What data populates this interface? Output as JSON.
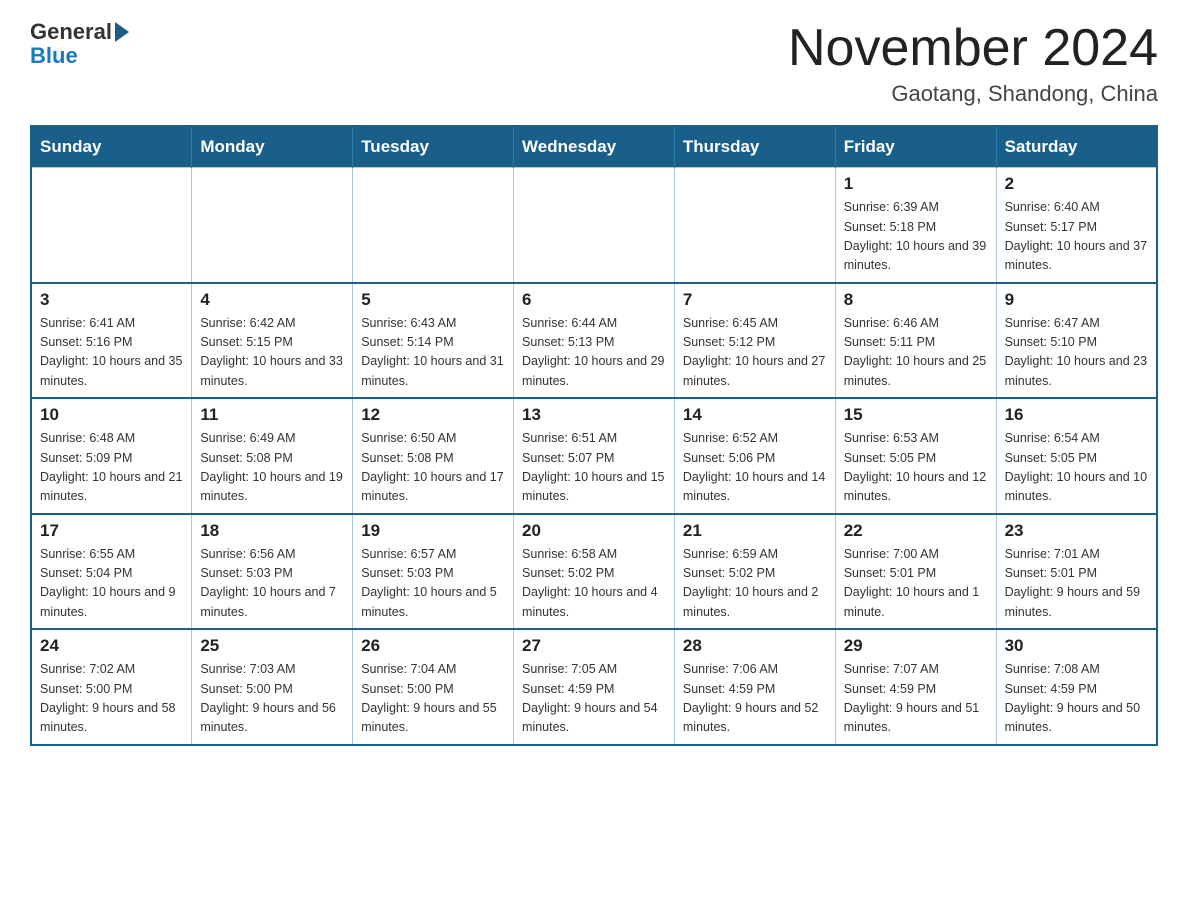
{
  "header": {
    "month_title": "November 2024",
    "location": "Gaotang, Shandong, China",
    "logo_general": "General",
    "logo_blue": "Blue"
  },
  "weekdays": [
    "Sunday",
    "Monday",
    "Tuesday",
    "Wednesday",
    "Thursday",
    "Friday",
    "Saturday"
  ],
  "weeks": [
    [
      {
        "day": "",
        "sunrise": "",
        "sunset": "",
        "daylight": ""
      },
      {
        "day": "",
        "sunrise": "",
        "sunset": "",
        "daylight": ""
      },
      {
        "day": "",
        "sunrise": "",
        "sunset": "",
        "daylight": ""
      },
      {
        "day": "",
        "sunrise": "",
        "sunset": "",
        "daylight": ""
      },
      {
        "day": "",
        "sunrise": "",
        "sunset": "",
        "daylight": ""
      },
      {
        "day": "1",
        "sunrise": "Sunrise: 6:39 AM",
        "sunset": "Sunset: 5:18 PM",
        "daylight": "Daylight: 10 hours and 39 minutes."
      },
      {
        "day": "2",
        "sunrise": "Sunrise: 6:40 AM",
        "sunset": "Sunset: 5:17 PM",
        "daylight": "Daylight: 10 hours and 37 minutes."
      }
    ],
    [
      {
        "day": "3",
        "sunrise": "Sunrise: 6:41 AM",
        "sunset": "Sunset: 5:16 PM",
        "daylight": "Daylight: 10 hours and 35 minutes."
      },
      {
        "day": "4",
        "sunrise": "Sunrise: 6:42 AM",
        "sunset": "Sunset: 5:15 PM",
        "daylight": "Daylight: 10 hours and 33 minutes."
      },
      {
        "day": "5",
        "sunrise": "Sunrise: 6:43 AM",
        "sunset": "Sunset: 5:14 PM",
        "daylight": "Daylight: 10 hours and 31 minutes."
      },
      {
        "day": "6",
        "sunrise": "Sunrise: 6:44 AM",
        "sunset": "Sunset: 5:13 PM",
        "daylight": "Daylight: 10 hours and 29 minutes."
      },
      {
        "day": "7",
        "sunrise": "Sunrise: 6:45 AM",
        "sunset": "Sunset: 5:12 PM",
        "daylight": "Daylight: 10 hours and 27 minutes."
      },
      {
        "day": "8",
        "sunrise": "Sunrise: 6:46 AM",
        "sunset": "Sunset: 5:11 PM",
        "daylight": "Daylight: 10 hours and 25 minutes."
      },
      {
        "day": "9",
        "sunrise": "Sunrise: 6:47 AM",
        "sunset": "Sunset: 5:10 PM",
        "daylight": "Daylight: 10 hours and 23 minutes."
      }
    ],
    [
      {
        "day": "10",
        "sunrise": "Sunrise: 6:48 AM",
        "sunset": "Sunset: 5:09 PM",
        "daylight": "Daylight: 10 hours and 21 minutes."
      },
      {
        "day": "11",
        "sunrise": "Sunrise: 6:49 AM",
        "sunset": "Sunset: 5:08 PM",
        "daylight": "Daylight: 10 hours and 19 minutes."
      },
      {
        "day": "12",
        "sunrise": "Sunrise: 6:50 AM",
        "sunset": "Sunset: 5:08 PM",
        "daylight": "Daylight: 10 hours and 17 minutes."
      },
      {
        "day": "13",
        "sunrise": "Sunrise: 6:51 AM",
        "sunset": "Sunset: 5:07 PM",
        "daylight": "Daylight: 10 hours and 15 minutes."
      },
      {
        "day": "14",
        "sunrise": "Sunrise: 6:52 AM",
        "sunset": "Sunset: 5:06 PM",
        "daylight": "Daylight: 10 hours and 14 minutes."
      },
      {
        "day": "15",
        "sunrise": "Sunrise: 6:53 AM",
        "sunset": "Sunset: 5:05 PM",
        "daylight": "Daylight: 10 hours and 12 minutes."
      },
      {
        "day": "16",
        "sunrise": "Sunrise: 6:54 AM",
        "sunset": "Sunset: 5:05 PM",
        "daylight": "Daylight: 10 hours and 10 minutes."
      }
    ],
    [
      {
        "day": "17",
        "sunrise": "Sunrise: 6:55 AM",
        "sunset": "Sunset: 5:04 PM",
        "daylight": "Daylight: 10 hours and 9 minutes."
      },
      {
        "day": "18",
        "sunrise": "Sunrise: 6:56 AM",
        "sunset": "Sunset: 5:03 PM",
        "daylight": "Daylight: 10 hours and 7 minutes."
      },
      {
        "day": "19",
        "sunrise": "Sunrise: 6:57 AM",
        "sunset": "Sunset: 5:03 PM",
        "daylight": "Daylight: 10 hours and 5 minutes."
      },
      {
        "day": "20",
        "sunrise": "Sunrise: 6:58 AM",
        "sunset": "Sunset: 5:02 PM",
        "daylight": "Daylight: 10 hours and 4 minutes."
      },
      {
        "day": "21",
        "sunrise": "Sunrise: 6:59 AM",
        "sunset": "Sunset: 5:02 PM",
        "daylight": "Daylight: 10 hours and 2 minutes."
      },
      {
        "day": "22",
        "sunrise": "Sunrise: 7:00 AM",
        "sunset": "Sunset: 5:01 PM",
        "daylight": "Daylight: 10 hours and 1 minute."
      },
      {
        "day": "23",
        "sunrise": "Sunrise: 7:01 AM",
        "sunset": "Sunset: 5:01 PM",
        "daylight": "Daylight: 9 hours and 59 minutes."
      }
    ],
    [
      {
        "day": "24",
        "sunrise": "Sunrise: 7:02 AM",
        "sunset": "Sunset: 5:00 PM",
        "daylight": "Daylight: 9 hours and 58 minutes."
      },
      {
        "day": "25",
        "sunrise": "Sunrise: 7:03 AM",
        "sunset": "Sunset: 5:00 PM",
        "daylight": "Daylight: 9 hours and 56 minutes."
      },
      {
        "day": "26",
        "sunrise": "Sunrise: 7:04 AM",
        "sunset": "Sunset: 5:00 PM",
        "daylight": "Daylight: 9 hours and 55 minutes."
      },
      {
        "day": "27",
        "sunrise": "Sunrise: 7:05 AM",
        "sunset": "Sunset: 4:59 PM",
        "daylight": "Daylight: 9 hours and 54 minutes."
      },
      {
        "day": "28",
        "sunrise": "Sunrise: 7:06 AM",
        "sunset": "Sunset: 4:59 PM",
        "daylight": "Daylight: 9 hours and 52 minutes."
      },
      {
        "day": "29",
        "sunrise": "Sunrise: 7:07 AM",
        "sunset": "Sunset: 4:59 PM",
        "daylight": "Daylight: 9 hours and 51 minutes."
      },
      {
        "day": "30",
        "sunrise": "Sunrise: 7:08 AM",
        "sunset": "Sunset: 4:59 PM",
        "daylight": "Daylight: 9 hours and 50 minutes."
      }
    ]
  ]
}
